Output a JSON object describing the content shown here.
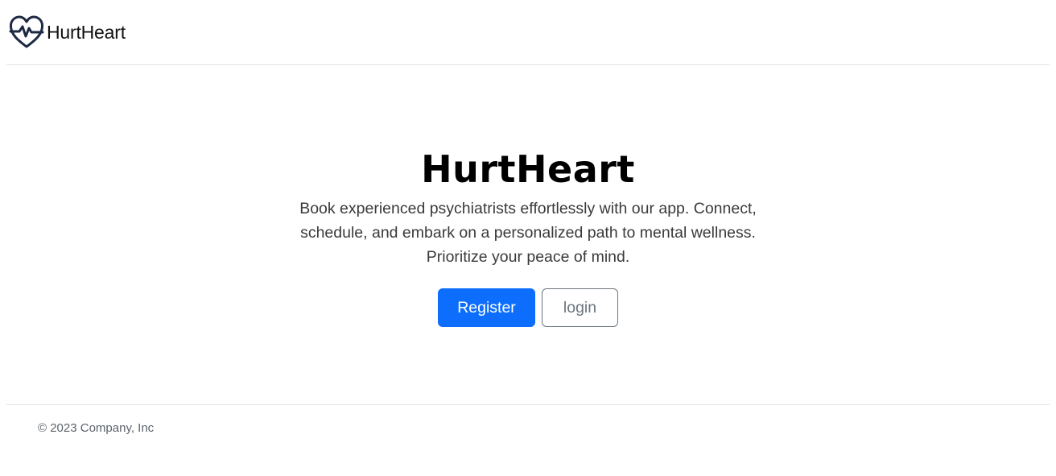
{
  "header": {
    "brand_name": "HurtHeart",
    "brand_icon": "heart-pulse-icon",
    "brand_icon_color": "#1e2a44"
  },
  "hero": {
    "title": "HurtHeart",
    "lead": "Book experienced psychiatrists effortlessly with our app. Connect, schedule, and embark on a personalized path to mental wellness. Prioritize your peace of mind.",
    "register_label": "Register",
    "login_label": "login"
  },
  "footer": {
    "copyright": "© 2023 Company, Inc"
  },
  "colors": {
    "primary": "#0d6efd",
    "secondary": "#6c757d",
    "divider": "#dee2e6"
  }
}
